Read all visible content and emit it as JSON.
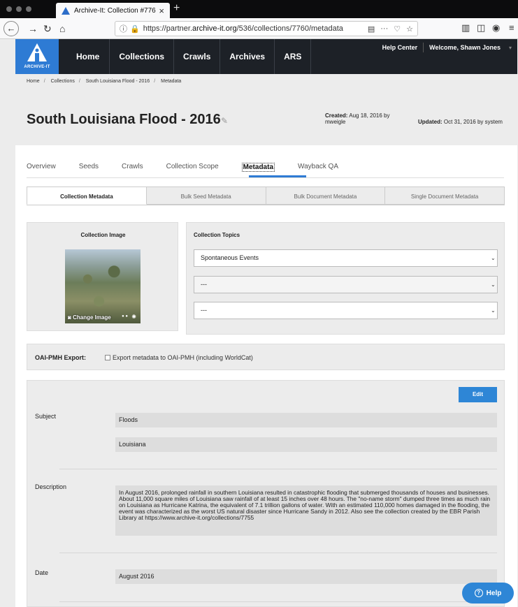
{
  "browser": {
    "tab_title": "Archive-It: Collection #7760",
    "tab_close": "×",
    "new_tab": "+",
    "url_prefix": "https://partner.",
    "url_host": "archive-it.org",
    "url_path": "/536/collections/7760/metadata",
    "page_actions": "···"
  },
  "site": {
    "brand": "ARCHIVE-IT",
    "nav": [
      "Home",
      "Collections",
      "Crawls",
      "Archives",
      "ARS"
    ],
    "help_center": "Help Center",
    "welcome": "Welcome, Shawn Jones",
    "caret": "▾"
  },
  "breadcrumb": {
    "items": [
      "Home",
      "Collections",
      "South Louisiana Flood - 2016",
      "Metadata"
    ],
    "separator": "/"
  },
  "page": {
    "title": "South Louisiana Flood - 2016",
    "created_label": "Created:",
    "created_value": "Aug 18, 2016 by mweigle",
    "updated_label": "Updated:",
    "updated_value": "Oct 31, 2016 by system"
  },
  "tabs": [
    "Overview",
    "Seeds",
    "Crawls",
    "Collection Scope",
    "Metadata",
    "Wayback QA"
  ],
  "subtabs": [
    "Collection Metadata",
    "Bulk Seed Metadata",
    "Bulk Document Metadata",
    "Single Document Metadata"
  ],
  "collection_image": {
    "heading": "Collection Image",
    "change_label": "Change Image"
  },
  "topics": {
    "heading": "Collection Topics",
    "selects": [
      "Spontaneous Events",
      "---",
      "---"
    ]
  },
  "oai": {
    "label": "OAI-PMH Export:",
    "checkbox_label": "Export metadata to OAI-PMH (including WorldCat)"
  },
  "metadata": {
    "edit_label": "Edit",
    "subject_label": "Subject",
    "subjects": [
      "Floods",
      "Louisiana"
    ],
    "description_label": "Description",
    "description": "In August 2016, prolonged rainfall in southern Louisiana resulted in catastrophic flooding that submerged thousands of houses and businesses. About 11,000 square miles of Louisiana saw rainfall of at least 15 inches over 48 hours. The \"no-name storm\" dumped three times as much rain on Louisiana as Hurricane Katrina, the equivalent of 7.1 trillion gallons of water. With an estimated 110,000 homes damaged in the flooding, the event was characterized as the worst US natural disaster since Hurricane Sandy in 2012. Also see the collection created by the EBR Parish Library at https://www.archive-it.org/collections/7755",
    "date_label": "Date",
    "date_value": "August 2016"
  },
  "help": {
    "label": "Help"
  },
  "colors": {
    "accent": "#2e7bd4",
    "header_bg": "#1d2127"
  }
}
